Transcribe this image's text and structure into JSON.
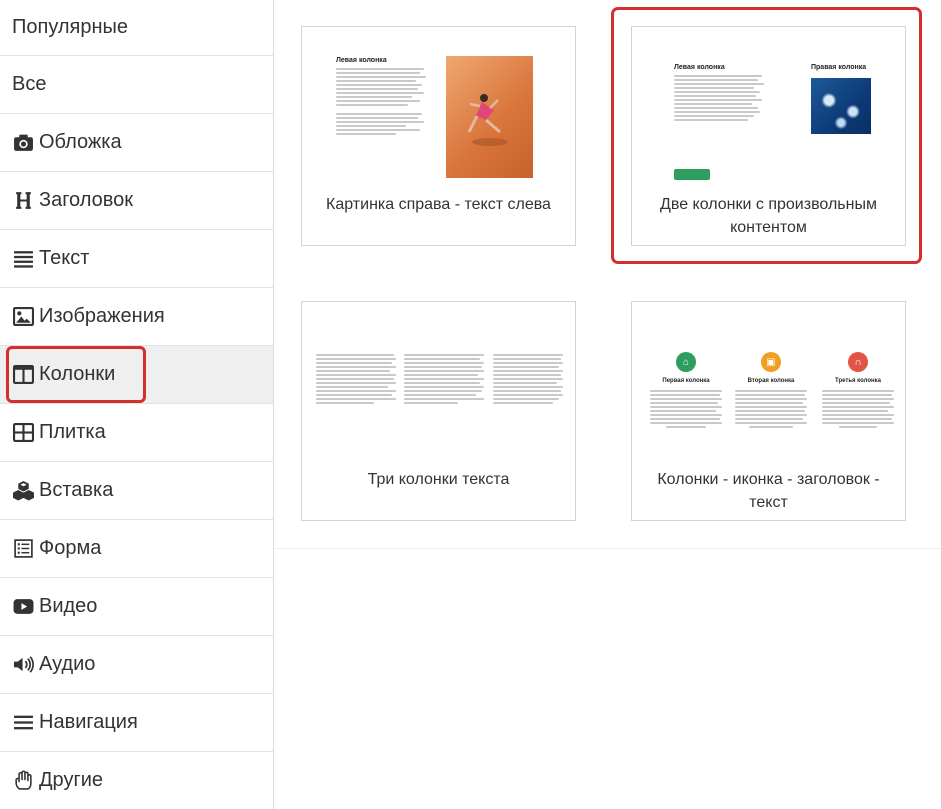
{
  "sidebar": {
    "items": [
      {
        "label": "Популярные",
        "icon": "",
        "active": false
      },
      {
        "label": "Все",
        "icon": "",
        "active": false
      },
      {
        "label": "Обложка",
        "icon": "camera-icon",
        "active": false
      },
      {
        "label": "Заголовок",
        "icon": "heading-icon",
        "active": false
      },
      {
        "label": "Текст",
        "icon": "text-lines-icon",
        "active": false
      },
      {
        "label": "Изображения",
        "icon": "image-icon",
        "active": false
      },
      {
        "label": "Колонки",
        "icon": "columns-icon",
        "active": true
      },
      {
        "label": "Плитка",
        "icon": "grid-icon",
        "active": false
      },
      {
        "label": "Вставка",
        "icon": "cubes-icon",
        "active": false
      },
      {
        "label": "Форма",
        "icon": "form-icon",
        "active": false
      },
      {
        "label": "Видео",
        "icon": "video-icon",
        "active": false
      },
      {
        "label": "Аудио",
        "icon": "speaker-icon",
        "active": false
      },
      {
        "label": "Навигация",
        "icon": "hamburger-icon",
        "active": false
      },
      {
        "label": "Другие",
        "icon": "hand-icon",
        "active": false
      }
    ]
  },
  "cards": [
    {
      "caption": "Картинка справа - текст слева",
      "thumb_heading": "Левая колонка"
    },
    {
      "caption": "Две колонки с произвольным контентом",
      "thumb_left_heading": "Левая колонка",
      "thumb_right_heading": "Правая колонка",
      "selected": true
    },
    {
      "caption": "Три колонки текста"
    },
    {
      "caption": "Колонки - иконка - заголовок - текст",
      "col1": "Первая колонка",
      "col2": "Вторая колонка",
      "col3": "Третья колонка"
    }
  ],
  "colors": {
    "highlight": "#d32f2f",
    "active_bg": "#efefef",
    "button_green": "#2e9e5e",
    "icon_green": "#2e9e5e",
    "icon_orange": "#f0a020",
    "icon_red": "#e05545"
  }
}
